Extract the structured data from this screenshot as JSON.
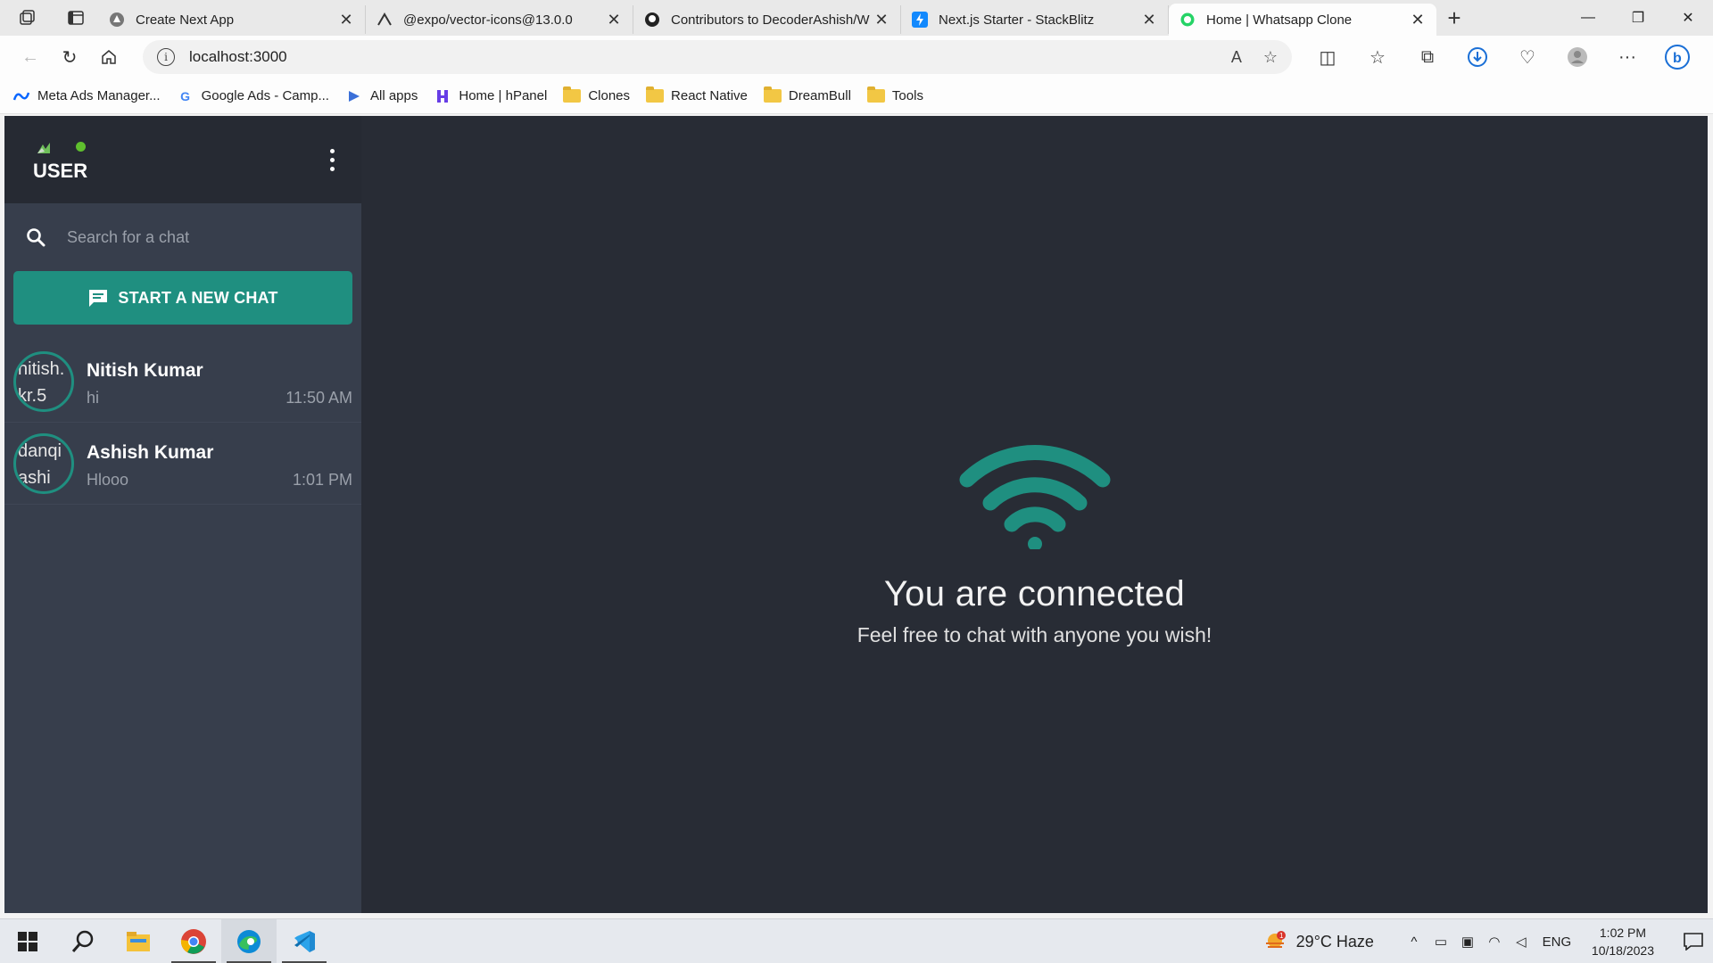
{
  "browser": {
    "tabs": [
      {
        "title": "Create Next App",
        "icon": "next-triangle-icon"
      },
      {
        "title": "@expo/vector-icons@13.0.0",
        "icon": "expo-icon"
      },
      {
        "title": "Contributors to DecoderAshish/W",
        "icon": "github-icon"
      },
      {
        "title": "Next.js Starter - StackBlitz",
        "icon": "stackblitz-icon"
      },
      {
        "title": "Home | Whatsapp Clone",
        "icon": "whatsapp-icon",
        "active": true
      }
    ],
    "url": "localhost:3000",
    "bookmarks": [
      {
        "label": "Meta Ads Manager...",
        "icon": "meta-icon"
      },
      {
        "label": "Google Ads - Camp...",
        "icon": "google-icon"
      },
      {
        "label": "All apps",
        "icon": "apps-icon"
      },
      {
        "label": "Home | hPanel",
        "icon": "hostinger-icon"
      },
      {
        "label": "Clones",
        "icon": "folder-icon"
      },
      {
        "label": "React Native",
        "icon": "folder-icon"
      },
      {
        "label": "DreamBull",
        "icon": "folder-icon"
      },
      {
        "label": "Tools",
        "icon": "folder-icon"
      }
    ]
  },
  "app": {
    "header": {
      "user_alt": "USER",
      "status_color": "#5fbf2e"
    },
    "search": {
      "placeholder": "Search for a chat"
    },
    "new_chat_label": "START A NEW CHAT",
    "chats": [
      {
        "name": "Nitish Kumar",
        "message": "hi",
        "time": "11:50 AM",
        "avatar_alt": "nitish.kr.5"
      },
      {
        "name": "Ashish Kumar",
        "message": "Hlooo",
        "time": "1:01 PM",
        "avatar_alt": "danqiashi"
      }
    ],
    "main": {
      "title": "You are connected",
      "subtitle": "Feel free to chat with anyone you wish!"
    },
    "colors": {
      "accent": "#1f8f80",
      "sidebar_bg": "#373e4c",
      "main_bg": "#282c35"
    }
  },
  "taskbar": {
    "weather": "29°C  Haze",
    "language": "ENG",
    "time": "1:02 PM",
    "date": "10/18/2023",
    "weather_badge": "1"
  }
}
